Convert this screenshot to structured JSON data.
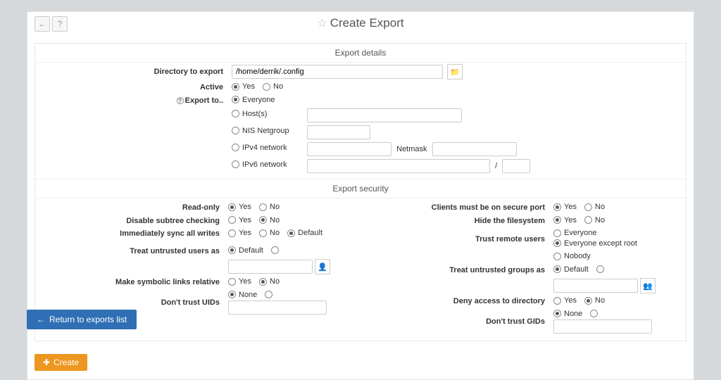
{
  "title": "Create Export",
  "sections": {
    "details": "Export details",
    "security": "Export security"
  },
  "details": {
    "dir_label": "Directory to export",
    "dir_value": "/home/derrik/.config",
    "active_label": "Active",
    "yes": "Yes",
    "no": "No",
    "export_to_label": "Export to..",
    "everyone": "Everyone",
    "hosts": "Host(s)",
    "nis": "NIS Netgroup",
    "ipv4": "IPv4 network",
    "netmask": "Netmask",
    "ipv6": "IPv6 network",
    "slash": "/"
  },
  "sec_left": {
    "readonly": "Read-only",
    "subtree": "Disable subtree checking",
    "sync": "Immediately sync all writes",
    "default": "Default",
    "treat_users": "Treat untrusted users as",
    "symlinks": "Make symbolic links relative",
    "dont_uid": "Don't trust UIDs",
    "none": "None"
  },
  "sec_right": {
    "secure_port": "Clients must be on secure port",
    "hide_fs": "Hide the filesystem",
    "trust_remote": "Trust remote users",
    "everyone": "Everyone",
    "except_root": "Everyone except root",
    "nobody": "Nobody",
    "treat_groups": "Treat untrusted groups as",
    "default": "Default",
    "deny": "Deny access to directory",
    "dont_gid": "Don't trust GIDs",
    "none": "None"
  },
  "buttons": {
    "create": "Create",
    "return": "Return to exports list"
  },
  "yn": {
    "yes": "Yes",
    "no": "No"
  }
}
